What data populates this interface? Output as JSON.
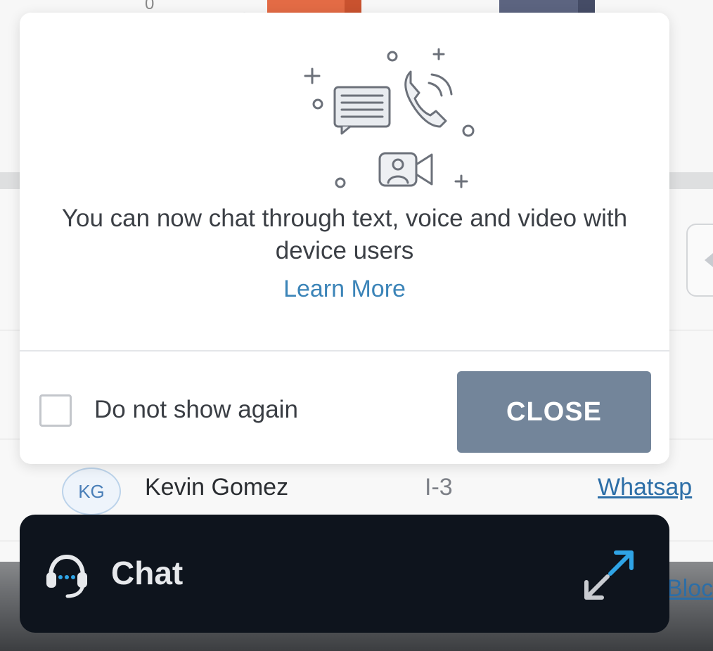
{
  "background": {
    "axis_zero": "0",
    "row": {
      "avatar_initials": "KG",
      "name": "Kevin Gomez",
      "id": "I-3",
      "channel": "Whatsap"
    },
    "row2_channel": "Bloc"
  },
  "popup": {
    "message": "You can now chat through text, voice and video with device users",
    "learn_more": "Learn More",
    "checkbox_label": "Do not show again",
    "close_label": "CLOSE"
  },
  "chat_bar": {
    "label": "Chat"
  },
  "icons": {
    "illustration": "chat-voice-video-illustration",
    "headset": "headset-icon",
    "expand": "expand-icon"
  },
  "colors": {
    "close_button": "#73859a",
    "link": "#3b84b8",
    "chat_bar": "#0e141d"
  }
}
